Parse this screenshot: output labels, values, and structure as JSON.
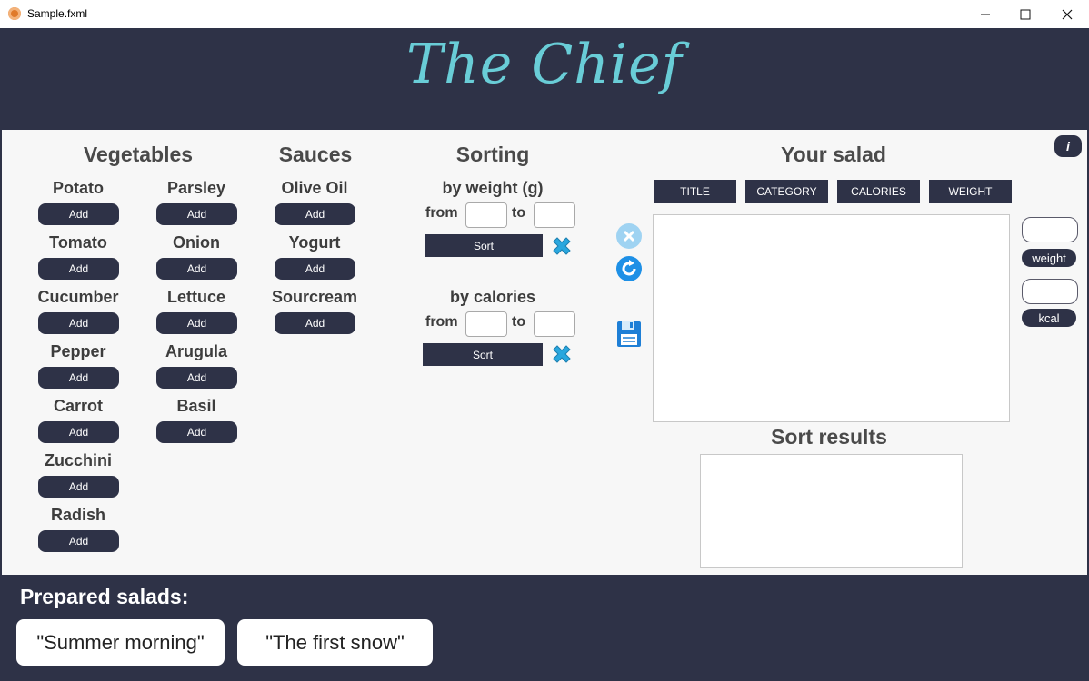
{
  "window": {
    "title": "Sample.fxml"
  },
  "brand": {
    "title": "The Chief"
  },
  "vegetables": {
    "heading": "Vegetables",
    "col1": [
      {
        "name": "Potato",
        "button": "Add"
      },
      {
        "name": "Tomato",
        "button": "Add"
      },
      {
        "name": "Cucumber",
        "button": "Add"
      },
      {
        "name": "Pepper",
        "button": "Add"
      },
      {
        "name": "Carrot",
        "button": "Add"
      },
      {
        "name": "Zucchini",
        "button": "Add"
      },
      {
        "name": "Radish",
        "button": "Add"
      }
    ],
    "col2": [
      {
        "name": "Parsley",
        "button": "Add"
      },
      {
        "name": "Onion",
        "button": "Add"
      },
      {
        "name": "Lettuce",
        "button": "Add"
      },
      {
        "name": "Arugula",
        "button": "Add"
      },
      {
        "name": "Basil",
        "button": "Add"
      }
    ]
  },
  "sauces": {
    "heading": "Sauces",
    "items": [
      {
        "name": "Olive Oil",
        "button": "Add"
      },
      {
        "name": "Yogurt",
        "button": "Add"
      },
      {
        "name": "Sourcream",
        "button": "Add"
      }
    ]
  },
  "sorting": {
    "heading": "Sorting",
    "weight": {
      "title": "by weight (g)",
      "from": "from",
      "to": "to",
      "from_value": "",
      "to_value": "",
      "button": "Sort"
    },
    "calories": {
      "title": "by calories",
      "from": "from",
      "to": "to",
      "from_value": "",
      "to_value": "",
      "button": "Sort"
    }
  },
  "salad": {
    "heading": "Your salad",
    "columns": [
      "TITLE",
      "CATEGORY",
      "CALORIES",
      "WEIGHT"
    ],
    "weight_label": "weight",
    "kcal_label": "kcal",
    "weight_value": "",
    "kcal_value": ""
  },
  "sort_results": {
    "heading": "Sort results"
  },
  "prepared": {
    "heading": "Prepared salads:",
    "items": [
      "\"Summer morning\"",
      "\"The first snow\""
    ]
  },
  "info": {
    "label": "i"
  },
  "colors": {
    "dark": "#2e3247",
    "accent": "#69cdd7",
    "icon_blue": "#1e90e6"
  }
}
